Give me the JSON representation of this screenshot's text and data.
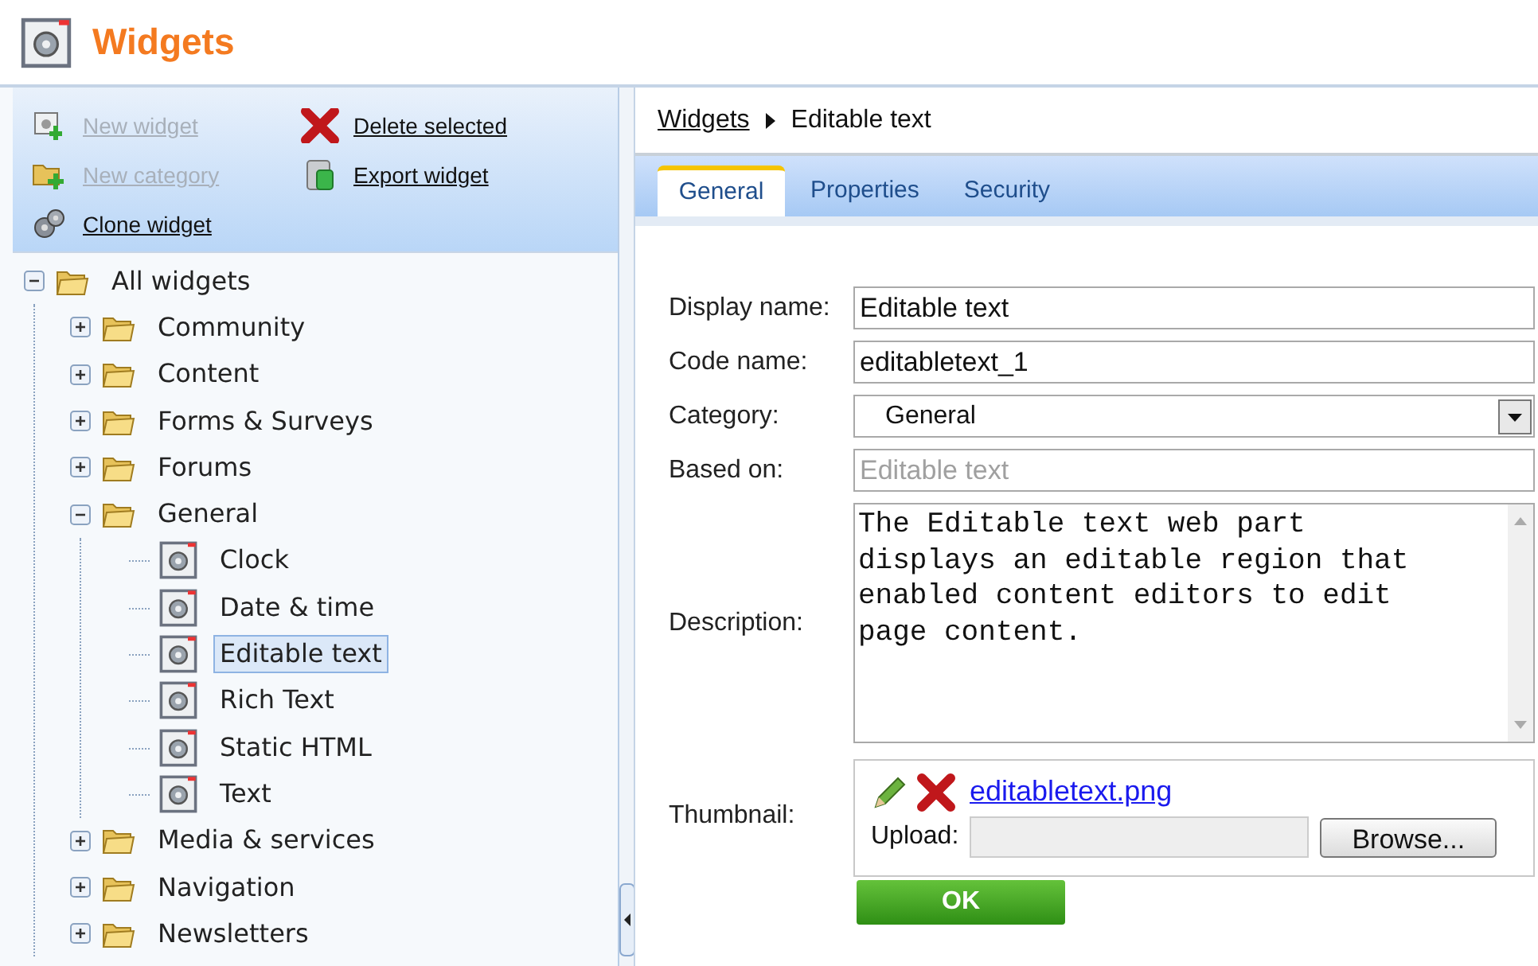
{
  "header": {
    "title": "Widgets"
  },
  "actions": [
    {
      "label": "New widget",
      "disabled": true
    },
    {
      "label": "Delete selected",
      "disabled": false
    },
    {
      "label": "New category",
      "disabled": true
    },
    {
      "label": "Export widget",
      "disabled": false
    },
    {
      "label": "Clone widget",
      "disabled": false
    }
  ],
  "tree": [
    {
      "label": "All widgets",
      "kind": "folder",
      "expanded": true,
      "selected": false,
      "children": [
        {
          "label": "Community",
          "kind": "folder",
          "expanded": false,
          "selected": false
        },
        {
          "label": "Content",
          "kind": "folder",
          "expanded": false,
          "selected": false
        },
        {
          "label": "Forms & Surveys",
          "kind": "folder",
          "expanded": false,
          "selected": false
        },
        {
          "label": "Forums",
          "kind": "folder",
          "expanded": false,
          "selected": false
        },
        {
          "label": "General",
          "kind": "folder",
          "expanded": true,
          "selected": false,
          "children": [
            {
              "label": "Clock",
              "kind": "widget",
              "selected": false
            },
            {
              "label": "Date & time",
              "kind": "widget",
              "selected": false
            },
            {
              "label": "Editable text",
              "kind": "widget",
              "selected": true
            },
            {
              "label": "Rich Text",
              "kind": "widget",
              "selected": false
            },
            {
              "label": "Static HTML",
              "kind": "widget",
              "selected": false
            },
            {
              "label": "Text",
              "kind": "widget",
              "selected": false
            }
          ]
        },
        {
          "label": "Media & services",
          "kind": "folder",
          "expanded": false,
          "selected": false
        },
        {
          "label": "Navigation",
          "kind": "folder",
          "expanded": false,
          "selected": false
        },
        {
          "label": "Newsletters",
          "kind": "folder",
          "expanded": false,
          "selected": false
        }
      ]
    }
  ],
  "breadcrumb": {
    "link": "Widgets",
    "current": "Editable text"
  },
  "tabs": [
    {
      "label": "General",
      "selected": true
    },
    {
      "label": "Properties",
      "selected": false
    },
    {
      "label": "Security",
      "selected": false
    }
  ],
  "form": [
    {
      "kind": "text",
      "label": "Display name:",
      "value": "Editable text",
      "disabled": false
    },
    {
      "kind": "text",
      "label": "Code name:",
      "value": "editabletext_1",
      "disabled": false
    },
    {
      "kind": "select",
      "label": "Category:",
      "value": "General"
    },
    {
      "kind": "text",
      "label": "Based on:",
      "value": "Editable text",
      "disabled": true
    },
    {
      "kind": "textarea",
      "label": "Description:",
      "value": "The Editable text web part displays an editable region that enabled content editors to edit page content."
    },
    {
      "kind": "thumbnail",
      "label": "Thumbnail:",
      "file": "editabletext.png",
      "upload_label": "Upload:",
      "browse": "Browse..."
    }
  ],
  "ok_button": "OK"
}
